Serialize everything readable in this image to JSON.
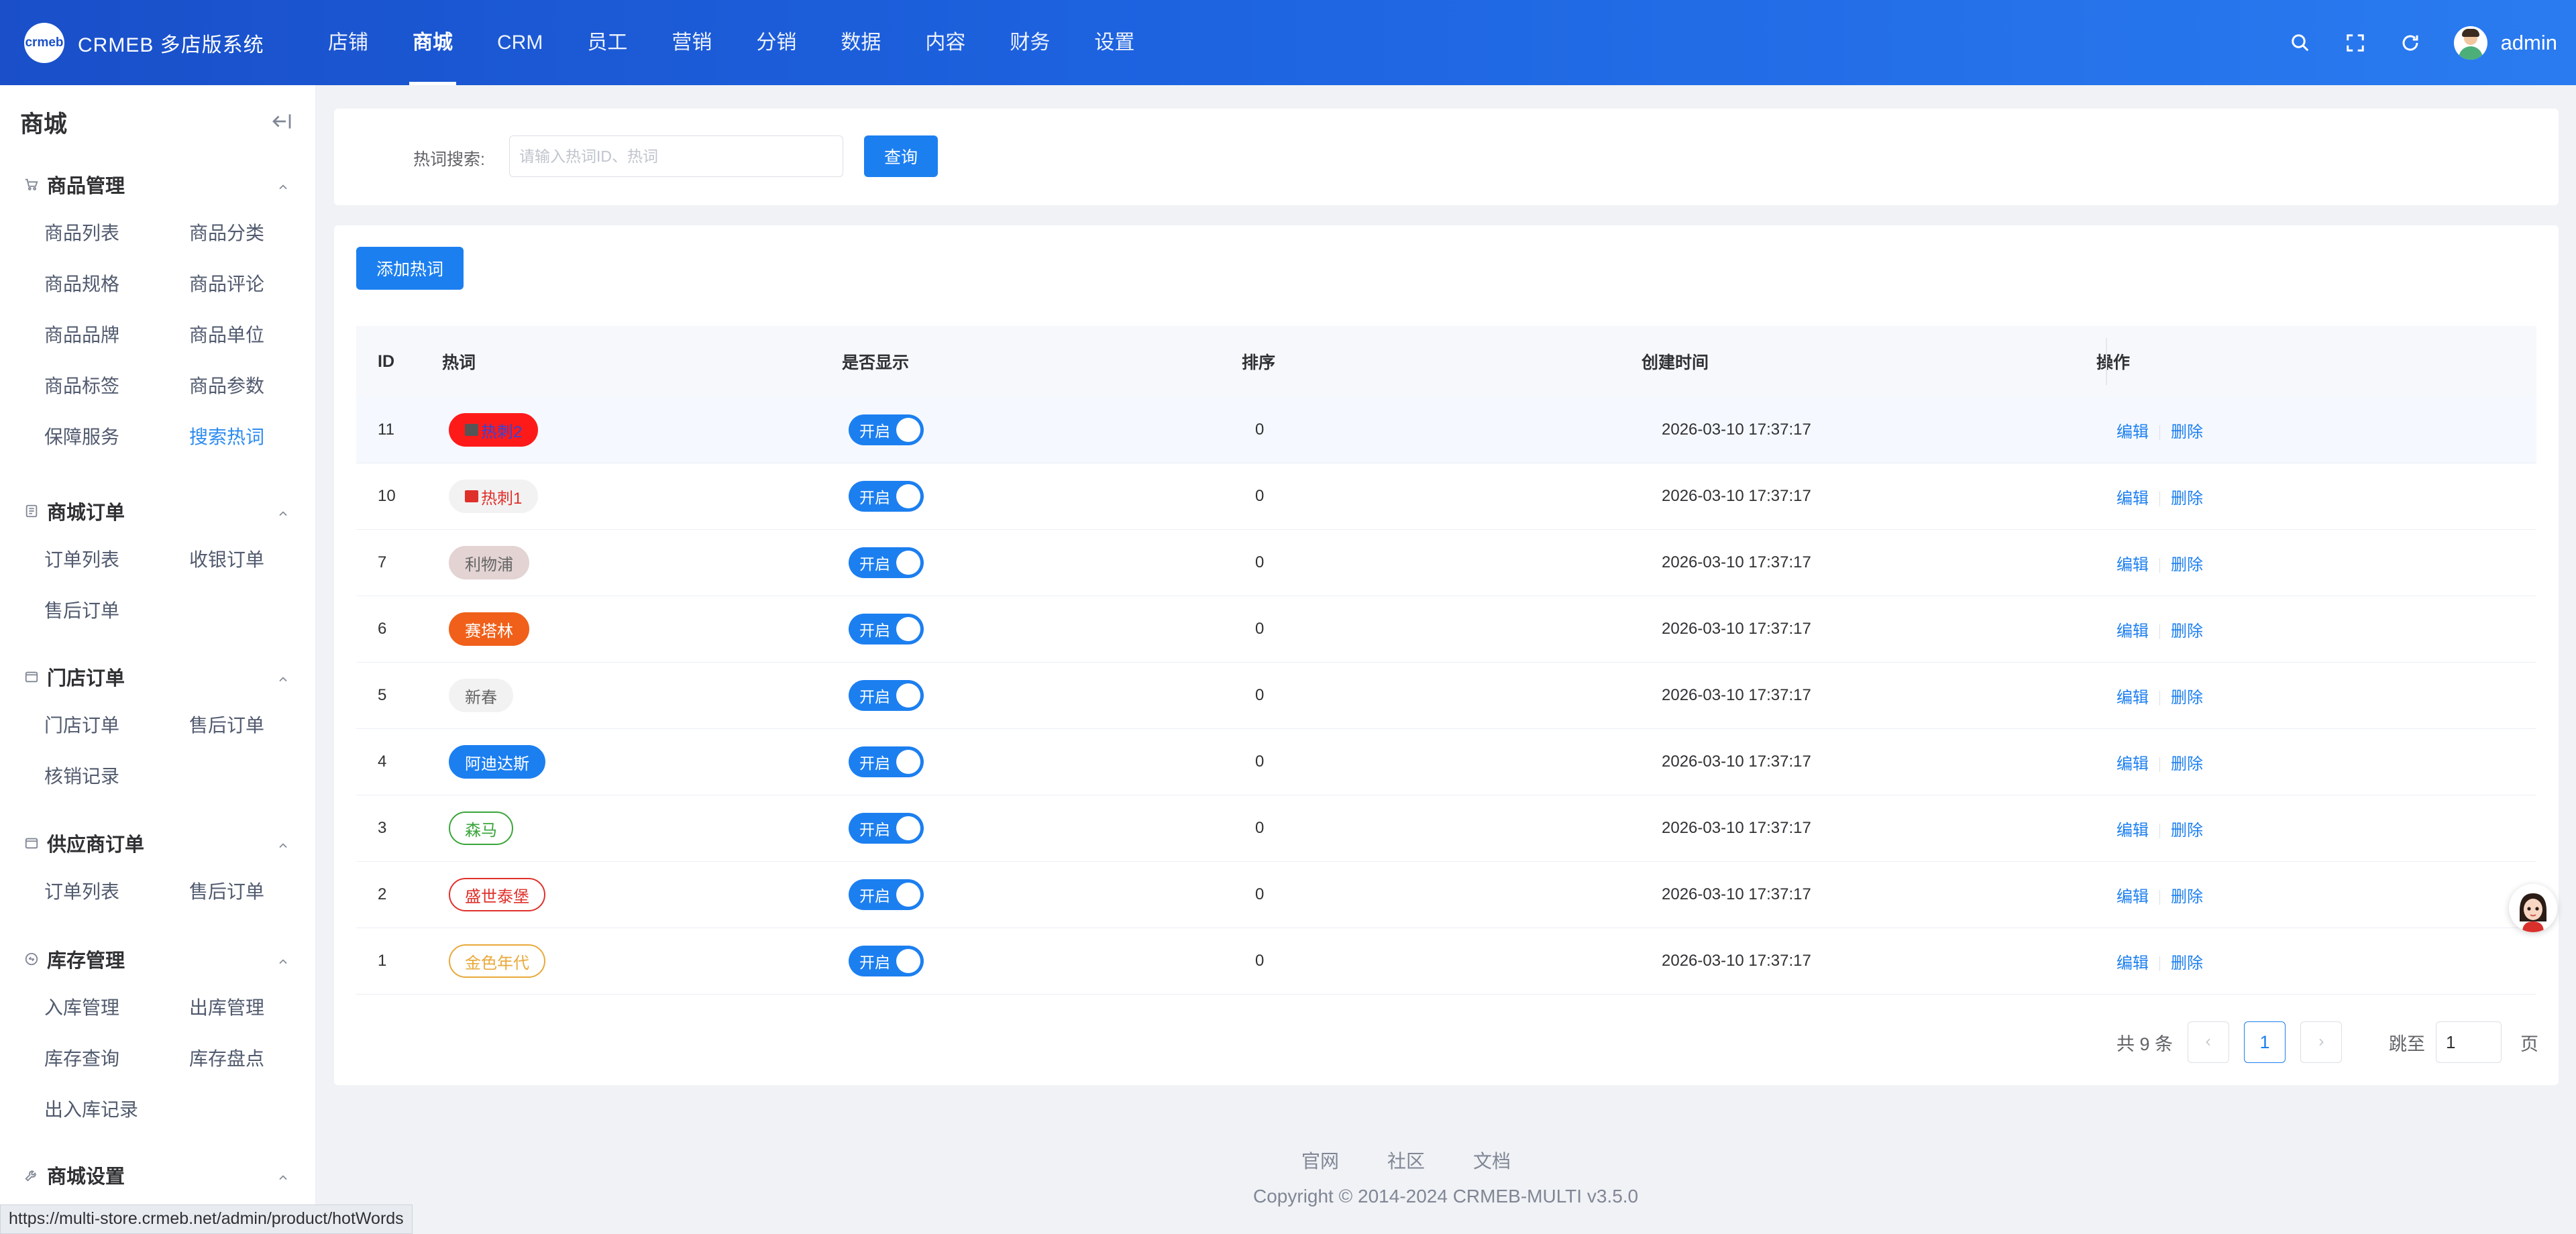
{
  "header": {
    "logo_text": "crmeb",
    "brand": "CRMEB 多店版系统",
    "nav": [
      {
        "label": "店铺",
        "active": false
      },
      {
        "label": "商城",
        "active": true
      },
      {
        "label": "CRM",
        "active": false
      },
      {
        "label": "员工",
        "active": false
      },
      {
        "label": "营销",
        "active": false
      },
      {
        "label": "分销",
        "active": false
      },
      {
        "label": "数据",
        "active": false
      },
      {
        "label": "内容",
        "active": false
      },
      {
        "label": "财务",
        "active": false
      },
      {
        "label": "设置",
        "active": false
      }
    ],
    "username": "admin"
  },
  "sidebar": {
    "title": "商城",
    "groups": [
      {
        "label": "商品管理",
        "icon": "cart-icon",
        "items": [
          "商品列表",
          "商品分类",
          "商品规格",
          "商品评论",
          "商品品牌",
          "商品单位",
          "商品标签",
          "商品参数",
          "保障服务",
          "搜索热词"
        ],
        "active_item": "搜索热词"
      },
      {
        "label": "商城订单",
        "icon": "order-icon",
        "items": [
          "订单列表",
          "收银订单",
          "售后订单"
        ]
      },
      {
        "label": "门店订单",
        "icon": "store-icon",
        "items": [
          "门店订单",
          "售后订单",
          "核销记录"
        ]
      },
      {
        "label": "供应商订单",
        "icon": "supplier-icon",
        "items": [
          "订单列表",
          "售后订单"
        ]
      },
      {
        "label": "库存管理",
        "icon": "stock-icon",
        "items": [
          "入库管理",
          "出库管理",
          "库存查询",
          "库存盘点",
          "出入库记录"
        ]
      },
      {
        "label": "商城设置",
        "icon": "wrench-icon",
        "items": []
      }
    ]
  },
  "search": {
    "label": "热词搜索:",
    "placeholder": "请输入热词ID、热词",
    "value": "",
    "button": "查询"
  },
  "toolbar": {
    "add_label": "添加热词"
  },
  "table": {
    "columns": [
      "ID",
      "热词",
      "是否显示",
      "排序",
      "创建时间",
      "操作"
    ],
    "switch_label": "开启",
    "edit_label": "编辑",
    "delete_label": "删除",
    "rows": [
      {
        "id": "11",
        "keyword": "热刺2",
        "bg": "#ff1a1a",
        "fg": "#2d47d9",
        "border": "#ff1a1a",
        "icon": true,
        "icon_color": "#555555",
        "shown": true,
        "sort": "0",
        "created": "2026-03-10 17:37:17"
      },
      {
        "id": "10",
        "keyword": "热刺1",
        "bg": "#f2f2f2",
        "fg": "#e0302a",
        "border": "#f2f2f2",
        "icon": true,
        "icon_color": "#e0302a",
        "shown": true,
        "sort": "0",
        "created": "2026-03-10 17:37:17"
      },
      {
        "id": "7",
        "keyword": "利物浦",
        "bg": "#e3d3d3",
        "fg": "#666666",
        "border": "#e3d3d3",
        "icon": false,
        "shown": true,
        "sort": "0",
        "created": "2026-03-10 17:37:17"
      },
      {
        "id": "6",
        "keyword": "赛塔林",
        "bg": "#f0601a",
        "fg": "#ffffff",
        "border": "#f0601a",
        "icon": false,
        "shown": true,
        "sort": "0",
        "created": "2026-03-10 17:37:17"
      },
      {
        "id": "5",
        "keyword": "新春",
        "bg": "#f2f2f2",
        "fg": "#666666",
        "border": "#f2f2f2",
        "icon": false,
        "shown": true,
        "sort": "0",
        "created": "2026-03-10 17:37:17"
      },
      {
        "id": "4",
        "keyword": "阿迪达斯",
        "bg": "#1c7ff0",
        "fg": "#ffffff",
        "border": "#1c7ff0",
        "icon": false,
        "shown": true,
        "sort": "0",
        "created": "2026-03-10 17:37:17"
      },
      {
        "id": "3",
        "keyword": "森马",
        "bg": "#ffffff",
        "fg": "#3aa53a",
        "border": "#3aa53a",
        "icon": false,
        "shown": true,
        "sort": "0",
        "created": "2026-03-10 17:37:17"
      },
      {
        "id": "2",
        "keyword": "盛世泰堡",
        "bg": "#ffffff",
        "fg": "#e0302a",
        "border": "#e0302a",
        "icon": false,
        "shown": true,
        "sort": "0",
        "created": "2026-03-10 17:37:17"
      },
      {
        "id": "1",
        "keyword": "金色年代",
        "bg": "#ffffff",
        "fg": "#e8a93a",
        "border": "#e8a93a",
        "icon": false,
        "shown": true,
        "sort": "0",
        "created": "2026-03-10 17:37:17"
      }
    ]
  },
  "pagination": {
    "total": "共 9 条",
    "current": "1",
    "goto_label": "跳至",
    "goto_value": "1",
    "goto_tail": "页"
  },
  "footer": {
    "links": [
      "官网",
      "社区",
      "文档"
    ],
    "copyright": "Copyright © 2014-2024 CRMEB-MULTI v3.5.0"
  },
  "status_url": "https://multi-store.crmeb.net/admin/product/hotWords",
  "colors": {
    "primary": "#1c7ff0",
    "header_start": "#1a4fc9",
    "header_end": "#2a7bf0"
  }
}
